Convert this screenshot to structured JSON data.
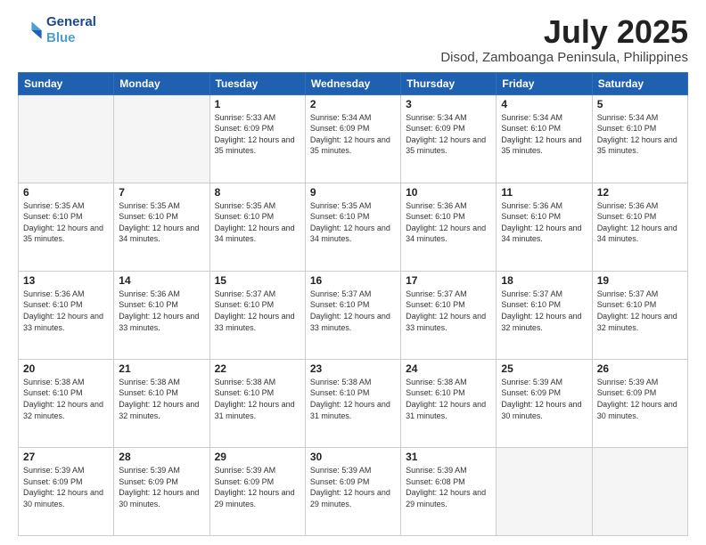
{
  "header": {
    "logo_line1": "General",
    "logo_line2": "Blue",
    "title": "July 2025",
    "subtitle": "Disod, Zamboanga Peninsula, Philippines"
  },
  "calendar": {
    "days_of_week": [
      "Sunday",
      "Monday",
      "Tuesday",
      "Wednesday",
      "Thursday",
      "Friday",
      "Saturday"
    ],
    "weeks": [
      [
        {
          "day": "",
          "empty": true
        },
        {
          "day": "",
          "empty": true
        },
        {
          "day": "1",
          "sunrise": "5:33 AM",
          "sunset": "6:09 PM",
          "daylight": "12 hours and 35 minutes."
        },
        {
          "day": "2",
          "sunrise": "5:34 AM",
          "sunset": "6:09 PM",
          "daylight": "12 hours and 35 minutes."
        },
        {
          "day": "3",
          "sunrise": "5:34 AM",
          "sunset": "6:09 PM",
          "daylight": "12 hours and 35 minutes."
        },
        {
          "day": "4",
          "sunrise": "5:34 AM",
          "sunset": "6:10 PM",
          "daylight": "12 hours and 35 minutes."
        },
        {
          "day": "5",
          "sunrise": "5:34 AM",
          "sunset": "6:10 PM",
          "daylight": "12 hours and 35 minutes."
        }
      ],
      [
        {
          "day": "6",
          "sunrise": "5:35 AM",
          "sunset": "6:10 PM",
          "daylight": "12 hours and 35 minutes."
        },
        {
          "day": "7",
          "sunrise": "5:35 AM",
          "sunset": "6:10 PM",
          "daylight": "12 hours and 34 minutes."
        },
        {
          "day": "8",
          "sunrise": "5:35 AM",
          "sunset": "6:10 PM",
          "daylight": "12 hours and 34 minutes."
        },
        {
          "day": "9",
          "sunrise": "5:35 AM",
          "sunset": "6:10 PM",
          "daylight": "12 hours and 34 minutes."
        },
        {
          "day": "10",
          "sunrise": "5:36 AM",
          "sunset": "6:10 PM",
          "daylight": "12 hours and 34 minutes."
        },
        {
          "day": "11",
          "sunrise": "5:36 AM",
          "sunset": "6:10 PM",
          "daylight": "12 hours and 34 minutes."
        },
        {
          "day": "12",
          "sunrise": "5:36 AM",
          "sunset": "6:10 PM",
          "daylight": "12 hours and 34 minutes."
        }
      ],
      [
        {
          "day": "13",
          "sunrise": "5:36 AM",
          "sunset": "6:10 PM",
          "daylight": "12 hours and 33 minutes."
        },
        {
          "day": "14",
          "sunrise": "5:36 AM",
          "sunset": "6:10 PM",
          "daylight": "12 hours and 33 minutes."
        },
        {
          "day": "15",
          "sunrise": "5:37 AM",
          "sunset": "6:10 PM",
          "daylight": "12 hours and 33 minutes."
        },
        {
          "day": "16",
          "sunrise": "5:37 AM",
          "sunset": "6:10 PM",
          "daylight": "12 hours and 33 minutes."
        },
        {
          "day": "17",
          "sunrise": "5:37 AM",
          "sunset": "6:10 PM",
          "daylight": "12 hours and 33 minutes."
        },
        {
          "day": "18",
          "sunrise": "5:37 AM",
          "sunset": "6:10 PM",
          "daylight": "12 hours and 32 minutes."
        },
        {
          "day": "19",
          "sunrise": "5:37 AM",
          "sunset": "6:10 PM",
          "daylight": "12 hours and 32 minutes."
        }
      ],
      [
        {
          "day": "20",
          "sunrise": "5:38 AM",
          "sunset": "6:10 PM",
          "daylight": "12 hours and 32 minutes."
        },
        {
          "day": "21",
          "sunrise": "5:38 AM",
          "sunset": "6:10 PM",
          "daylight": "12 hours and 32 minutes."
        },
        {
          "day": "22",
          "sunrise": "5:38 AM",
          "sunset": "6:10 PM",
          "daylight": "12 hours and 31 minutes."
        },
        {
          "day": "23",
          "sunrise": "5:38 AM",
          "sunset": "6:10 PM",
          "daylight": "12 hours and 31 minutes."
        },
        {
          "day": "24",
          "sunrise": "5:38 AM",
          "sunset": "6:10 PM",
          "daylight": "12 hours and 31 minutes."
        },
        {
          "day": "25",
          "sunrise": "5:39 AM",
          "sunset": "6:09 PM",
          "daylight": "12 hours and 30 minutes."
        },
        {
          "day": "26",
          "sunrise": "5:39 AM",
          "sunset": "6:09 PM",
          "daylight": "12 hours and 30 minutes."
        }
      ],
      [
        {
          "day": "27",
          "sunrise": "5:39 AM",
          "sunset": "6:09 PM",
          "daylight": "12 hours and 30 minutes."
        },
        {
          "day": "28",
          "sunrise": "5:39 AM",
          "sunset": "6:09 PM",
          "daylight": "12 hours and 30 minutes."
        },
        {
          "day": "29",
          "sunrise": "5:39 AM",
          "sunset": "6:09 PM",
          "daylight": "12 hours and 29 minutes."
        },
        {
          "day": "30",
          "sunrise": "5:39 AM",
          "sunset": "6:09 PM",
          "daylight": "12 hours and 29 minutes."
        },
        {
          "day": "31",
          "sunrise": "5:39 AM",
          "sunset": "6:08 PM",
          "daylight": "12 hours and 29 minutes."
        },
        {
          "day": "",
          "empty": true
        },
        {
          "day": "",
          "empty": true
        }
      ]
    ]
  }
}
